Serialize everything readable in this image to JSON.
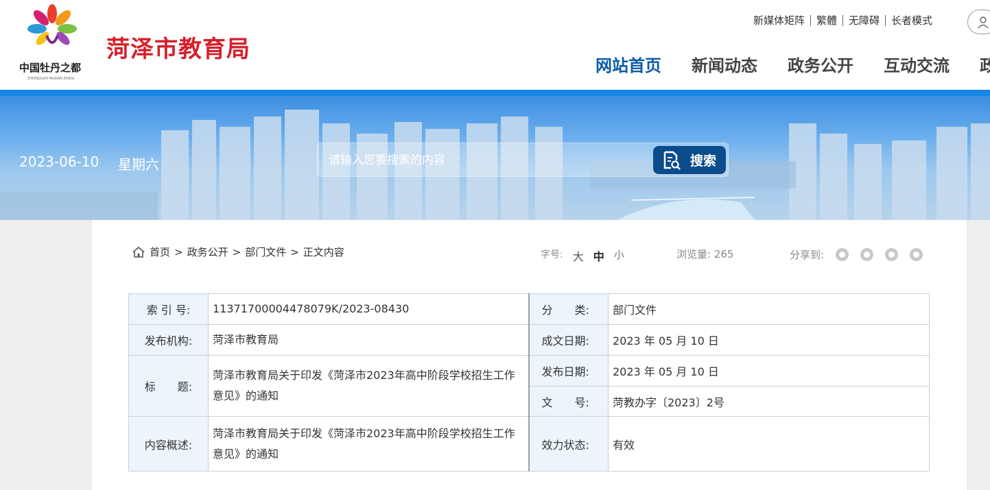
{
  "header": {
    "site_name": "菏泽市教育局",
    "logo_text": "中国牡丹之都",
    "top_links": [
      "新媒体矩阵",
      "繁體",
      "无障碍",
      "长者模式"
    ],
    "nav": [
      "网站首页",
      "新闻动态",
      "政务公开",
      "互动交流",
      "政"
    ],
    "colors": {
      "brand_red": "#d6202a",
      "nav_active": "#0b5aa8",
      "bar_blue": "#1586e6"
    }
  },
  "banner": {
    "date": "2023-06-10",
    "weekday": "星期六",
    "search_placeholder": "请输入您要搜索的内容",
    "search_button": "搜索"
  },
  "breadcrumb": [
    "首页",
    "政务公开",
    "部门文件",
    "正文内容"
  ],
  "tools": {
    "font_label": "字号:",
    "font_sizes": [
      "大",
      "中",
      "小"
    ],
    "views_label": "浏览量:",
    "views": "265",
    "share_label": "分享到:",
    "share_icons": [
      "wechat-icon",
      "weibo-icon",
      "qq-icon",
      "qzone-icon"
    ]
  },
  "meta": {
    "index_label": "索 引 号:",
    "index_value": "11371700004478079K/2023-08430",
    "category_label": "分　　类:",
    "category_value": "部门文件",
    "publisher_label": "发布机构:",
    "publisher_value": "菏泽市教育局",
    "written_label": "成文日期:",
    "written_value": "2023 年 05 月 10 日",
    "title_label": "标　　题:",
    "title_value": "菏泽市教育局关于印发《菏泽市2023年高中阶段学校招生工作意见》的通知",
    "published_label": "发布日期:",
    "published_value": "2023 年 05 月 10 日",
    "docno_label": "文　　号:",
    "docno_value": "菏教办字〔2023〕2号",
    "summary_label": "内容概述:",
    "summary_value": "菏泽市教育局关于印发《菏泽市2023年高中阶段学校招生工作意见》的通知",
    "status_label": "效力状态:",
    "status_value": "有效"
  }
}
